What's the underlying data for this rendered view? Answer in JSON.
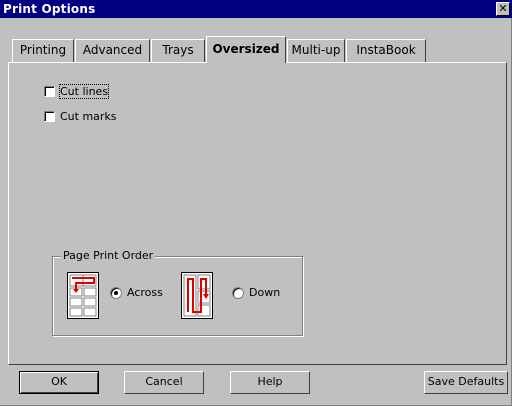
{
  "window": {
    "title": "Print Options",
    "close_glyph": "✕"
  },
  "tabs": [
    {
      "label": "Printing",
      "active": false
    },
    {
      "label": "Advanced",
      "active": false
    },
    {
      "label": "Trays",
      "active": false
    },
    {
      "label": "Oversized",
      "active": true
    },
    {
      "label": "Multi-up",
      "active": false
    },
    {
      "label": "InstaBook",
      "active": false
    }
  ],
  "options": {
    "cut_lines": {
      "label": "Cut lines",
      "checked": false
    },
    "cut_marks": {
      "label": "Cut marks",
      "checked": false
    }
  },
  "page_print_order": {
    "title": "Page Print Order",
    "across": {
      "label": "Across",
      "selected": true,
      "icon": "across-order-icon"
    },
    "down": {
      "label": "Down",
      "selected": false,
      "icon": "down-order-icon"
    }
  },
  "buttons": {
    "ok": "OK",
    "cancel": "Cancel",
    "help": "Help",
    "save_defaults": "Save Defaults"
  },
  "colors": {
    "titlebar": "#000080",
    "face": "#c0c0c0",
    "icon_red": "#e00000"
  }
}
